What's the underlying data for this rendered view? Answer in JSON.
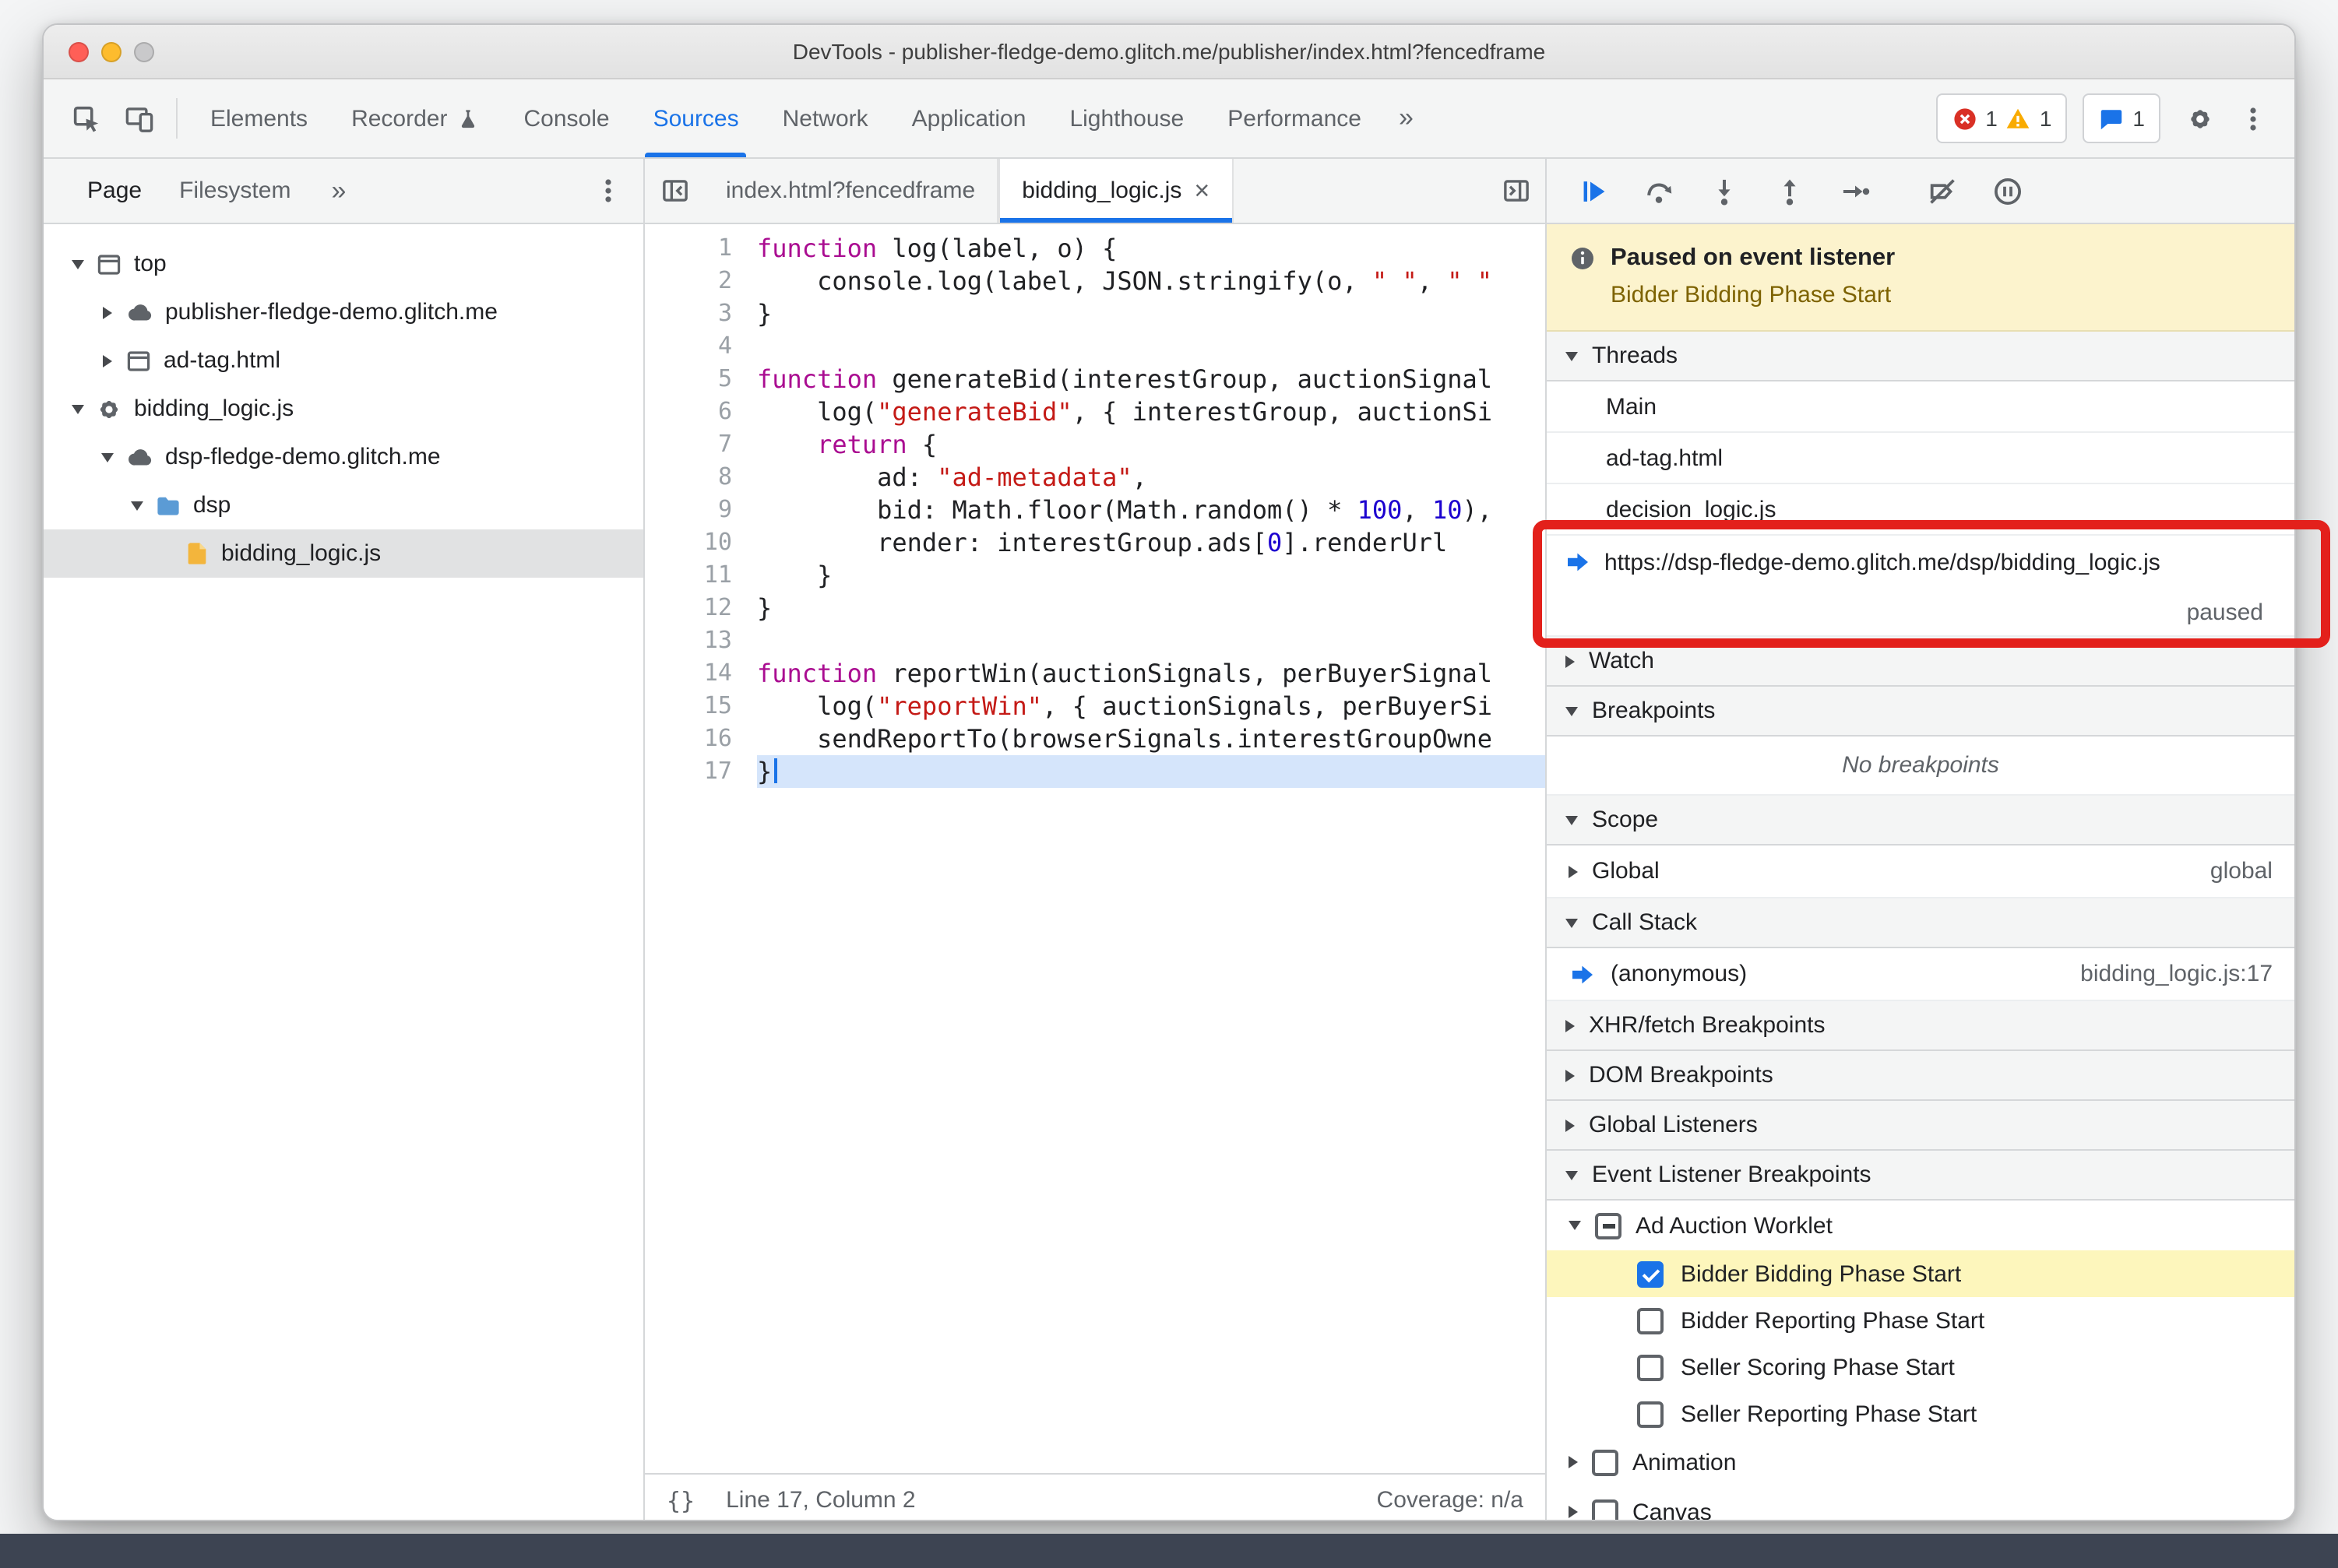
{
  "window": {
    "title": "DevTools - publisher-fledge-demo.glitch.me/publisher/index.html?fencedframe"
  },
  "colors": {
    "accent": "#1a73e8",
    "annotation_red": "#e3201b",
    "paused_banner_bg": "#fcf3cd",
    "execution_line_bg": "#d5e5fb",
    "checked_row_bg": "#fdf6bc",
    "selected_tree_row_bg": "#e1e2e3",
    "keyword": "#aa0d91",
    "string": "#c41a16",
    "number": "#1c00cf"
  },
  "toolbar": {
    "left_icons": [
      "inspect",
      "device-toolbar"
    ],
    "tabs": [
      {
        "label": "Elements"
      },
      {
        "label": "Recorder",
        "icon": "flask"
      },
      {
        "label": "Console"
      },
      {
        "label": "Sources",
        "active": true
      },
      {
        "label": "Network"
      },
      {
        "label": "Application"
      },
      {
        "label": "Lighthouse"
      },
      {
        "label": "Performance"
      }
    ],
    "overflow_chevron": "»",
    "error_count": "1",
    "warning_count": "1",
    "issues_count": "1",
    "right_icons": [
      "settings",
      "more-options"
    ]
  },
  "navigator": {
    "tabs": [
      {
        "label": "Page",
        "active": true
      },
      {
        "label": "Filesystem"
      }
    ],
    "overflow_chevron": "»",
    "tree": [
      {
        "label": "top",
        "depth": 0,
        "icon": "frame",
        "expanded": true
      },
      {
        "label": "publisher-fledge-demo.glitch.me",
        "depth": 1,
        "icon": "cloud",
        "expanded": false
      },
      {
        "label": "ad-tag.html",
        "depth": 1,
        "icon": "frame",
        "expanded": false
      },
      {
        "label": "bidding_logic.js",
        "depth": 0,
        "icon": "worklet",
        "expanded": true
      },
      {
        "label": "dsp-fledge-demo.glitch.me",
        "depth": 1,
        "icon": "cloud",
        "expanded": true
      },
      {
        "label": "dsp",
        "depth": 2,
        "icon": "folder",
        "expanded": true
      },
      {
        "label": "bidding_logic.js",
        "depth": 3,
        "icon": "file",
        "selected": true
      }
    ]
  },
  "editor": {
    "tabs": [
      {
        "label": "index.html?fencedframe"
      },
      {
        "label": "bidding_logic.js",
        "active": true,
        "close": "×"
      }
    ],
    "status": {
      "format": "{}",
      "position": "Line 17, Column 2",
      "coverage": "Coverage: n/a"
    },
    "code": [
      {
        "n": 1,
        "seg": [
          [
            "k",
            "function"
          ],
          [
            "p",
            " log(label, o) {"
          ]
        ]
      },
      {
        "n": 2,
        "seg": [
          [
            "p",
            "    console.log(label, JSON.stringify(o, "
          ],
          [
            "s",
            "\" \""
          ],
          [
            "p",
            ", "
          ],
          [
            "s",
            "\" \""
          ]
        ]
      },
      {
        "n": 3,
        "seg": [
          [
            "p",
            "}"
          ]
        ]
      },
      {
        "n": 4,
        "seg": []
      },
      {
        "n": 5,
        "seg": [
          [
            "k",
            "function"
          ],
          [
            "p",
            " generateBid(interestGroup, auctionSignal"
          ]
        ]
      },
      {
        "n": 6,
        "seg": [
          [
            "p",
            "    log("
          ],
          [
            "s",
            "\"generateBid\""
          ],
          [
            "p",
            ", { interestGroup, auctionSi"
          ]
        ]
      },
      {
        "n": 7,
        "seg": [
          [
            "p",
            "    "
          ],
          [
            "k",
            "return"
          ],
          [
            "p",
            " {"
          ]
        ]
      },
      {
        "n": 8,
        "seg": [
          [
            "p",
            "        ad: "
          ],
          [
            "s",
            "\"ad-metadata\""
          ],
          [
            "p",
            ","
          ]
        ]
      },
      {
        "n": 9,
        "seg": [
          [
            "p",
            "        bid: Math.floor(Math.random() * "
          ],
          [
            "n2",
            "100"
          ],
          [
            "p",
            ", "
          ],
          [
            "n2",
            "10"
          ],
          [
            "p",
            "),"
          ]
        ]
      },
      {
        "n": 10,
        "seg": [
          [
            "p",
            "        render: interestGroup.ads["
          ],
          [
            "n2",
            "0"
          ],
          [
            "p",
            "].renderUrl"
          ]
        ]
      },
      {
        "n": 11,
        "seg": [
          [
            "p",
            "    }"
          ]
        ]
      },
      {
        "n": 12,
        "seg": [
          [
            "p",
            "}"
          ]
        ]
      },
      {
        "n": 13,
        "seg": []
      },
      {
        "n": 14,
        "seg": [
          [
            "k",
            "function"
          ],
          [
            "p",
            " reportWin(auctionSignals, perBuyerSignal"
          ]
        ]
      },
      {
        "n": 15,
        "seg": [
          [
            "p",
            "    log("
          ],
          [
            "s",
            "\"reportWin\""
          ],
          [
            "p",
            ", { auctionSignals, perBuyerSi"
          ]
        ]
      },
      {
        "n": 16,
        "seg": [
          [
            "p",
            "    sendReportTo(browserSignals.interestGroupOwne"
          ]
        ]
      },
      {
        "n": 17,
        "seg": [
          [
            "p",
            "}"
          ]
        ],
        "current": true
      }
    ]
  },
  "debugger": {
    "buttons": [
      "resume",
      "step-over",
      "step-into",
      "step-out",
      "step",
      "deactivate-breakpoints",
      "pause-on-exceptions"
    ],
    "paused": {
      "title": "Paused on event listener",
      "reason": "Bidder Bidding Phase Start"
    },
    "threads": {
      "title": "Threads",
      "items": [
        {
          "label": "Main"
        },
        {
          "label": "ad-tag.html"
        },
        {
          "label": "decision_logic.js"
        },
        {
          "label": "https://dsp-fledge-demo.glitch.me/dsp/bidding_logic.js",
          "active": true,
          "status": "paused"
        }
      ]
    },
    "watch_title": "Watch",
    "breakpoints": {
      "title": "Breakpoints",
      "empty_message": "No breakpoints"
    },
    "scope": {
      "title": "Scope",
      "rows": [
        {
          "name": "Global",
          "value": "global"
        }
      ]
    },
    "call_stack": {
      "title": "Call Stack",
      "frames": [
        {
          "name": "(anonymous)",
          "location": "bidding_logic.js:17"
        }
      ]
    },
    "collapsed_sections": [
      "XHR/fetch Breakpoints",
      "DOM Breakpoints",
      "Global Listeners"
    ],
    "event_listener_breakpoints": {
      "title": "Event Listener Breakpoints",
      "categories": [
        {
          "label": "Ad Auction Worklet",
          "checkbox": "indeterminate",
          "expanded": true,
          "children": [
            {
              "label": "Bidder Bidding Phase Start",
              "checked": true,
              "highlighted": true
            },
            {
              "label": "Bidder Reporting Phase Start",
              "checked": false
            },
            {
              "label": "Seller Scoring Phase Start",
              "checked": false
            },
            {
              "label": "Seller Reporting Phase Start",
              "checked": false
            }
          ]
        },
        {
          "label": "Animation",
          "checkbox": "unchecked",
          "expanded": false
        },
        {
          "label": "Canvas",
          "checkbox": "unchecked",
          "expanded": false
        }
      ]
    }
  }
}
